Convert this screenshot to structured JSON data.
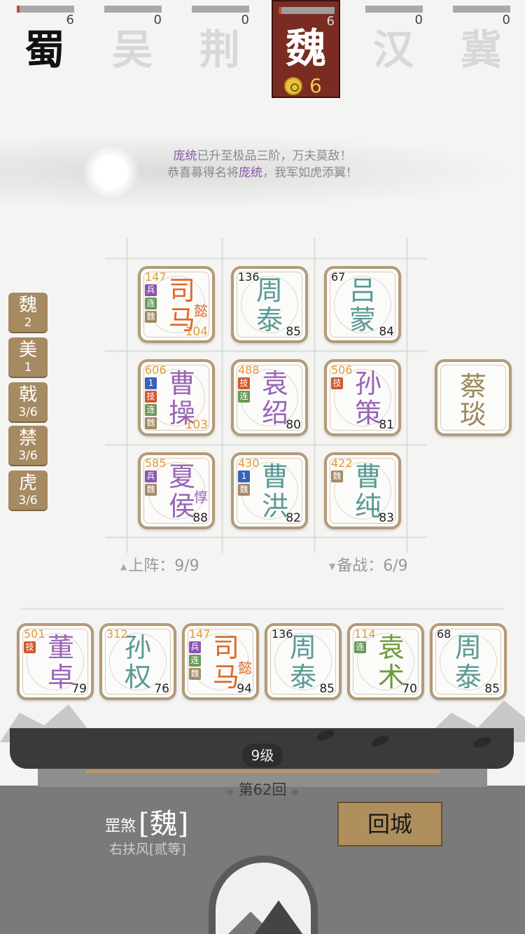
{
  "factions": [
    {
      "key": "shu",
      "glyph": "蜀",
      "count": "6",
      "progress": 0.05,
      "state": "dark"
    },
    {
      "key": "wu",
      "glyph": "吴",
      "count": "0",
      "progress": 0,
      "state": "light"
    },
    {
      "key": "jing",
      "glyph": "荆",
      "count": "0",
      "progress": 0,
      "state": "light"
    },
    {
      "key": "wei",
      "glyph": "魏",
      "count": "6",
      "progress": 0.05,
      "state": "active",
      "coins": "6"
    },
    {
      "key": "han",
      "glyph": "汉",
      "count": "0",
      "progress": 0,
      "state": "light"
    },
    {
      "key": "ji",
      "glyph": "冀",
      "count": "0",
      "progress": 0,
      "state": "light"
    }
  ],
  "notices": {
    "line1": {
      "hl": "庞统",
      "text": "已升至极品三阶，万夫莫敌！"
    },
    "line2": {
      "pre": "恭喜募得名将",
      "hl": "庞统",
      "text": "，我军如虎添翼！"
    }
  },
  "side_tags": [
    {
      "title": "魏",
      "value": "2"
    },
    {
      "title": "美",
      "value": "1"
    },
    {
      "title": "戟",
      "value": "3/6"
    },
    {
      "title": "禁",
      "value": "3/6"
    },
    {
      "title": "虎",
      "value": "3/6"
    }
  ],
  "board": [
    {
      "name_top": "司",
      "name_bot": "马",
      "stat": "147",
      "power": "104",
      "sub": "懿",
      "color": "orange",
      "badges": [
        {
          "t": "兵",
          "c": "purple"
        },
        {
          "t": "连",
          "c": "green"
        },
        {
          "t": "魏",
          "c": "tan"
        }
      ],
      "power_style": "orange"
    },
    {
      "name_top": "周",
      "name_bot": "泰",
      "stat": "136",
      "power": "85",
      "color": "teal",
      "badges": [],
      "stat_style": "black"
    },
    {
      "name_top": "吕",
      "name_bot": "蒙",
      "stat": "67",
      "power": "84",
      "color": "teal",
      "badges": [],
      "stat_style": "black"
    },
    {
      "name_top": "曹",
      "name_bot": "操",
      "stat": "606",
      "power": "103",
      "color": "purple",
      "badges": [
        {
          "t": "1",
          "c": "blue"
        },
        {
          "t": "技",
          "c": "orange"
        },
        {
          "t": "连",
          "c": "green"
        },
        {
          "t": "魏",
          "c": "tan"
        }
      ],
      "power_style": "orange"
    },
    {
      "name_top": "袁",
      "name_bot": "绍",
      "stat": "488",
      "power": "80",
      "color": "purple",
      "badges": [
        {
          "t": "技",
          "c": "orange"
        },
        {
          "t": "连",
          "c": "green"
        }
      ]
    },
    {
      "name_top": "孙",
      "name_bot": "策",
      "stat": "506",
      "power": "81",
      "color": "purple",
      "badges": [
        {
          "t": "技",
          "c": "orange"
        }
      ]
    },
    {
      "name_top": "夏",
      "name_bot": "侯",
      "stat": "585",
      "power": "88",
      "sub": "惇",
      "color": "purple",
      "badges": [
        {
          "t": "兵",
          "c": "purple"
        },
        {
          "t": "魏",
          "c": "tan"
        }
      ]
    },
    {
      "name_top": "曹",
      "name_bot": "洪",
      "stat": "430",
      "power": "82",
      "color": "teal",
      "badges": [
        {
          "t": "1",
          "c": "blue"
        },
        {
          "t": "魏",
          "c": "tan"
        }
      ]
    },
    {
      "name_top": "曹",
      "name_bot": "纯",
      "stat": "422",
      "power": "83",
      "color": "teal",
      "badges": [
        {
          "t": "魏",
          "c": "tan"
        }
      ]
    }
  ],
  "single_card": {
    "name_top": "蔡",
    "name_bot": "琰",
    "color": "brown"
  },
  "counters": {
    "deployed": "上阵：9/9",
    "reserve": "备战：6/9"
  },
  "bench": [
    {
      "name_top": "董",
      "name_bot": "卓",
      "stat": "501",
      "power": "79",
      "color": "purple",
      "badges": [
        {
          "t": "技",
          "c": "orange"
        }
      ]
    },
    {
      "name_top": "孙",
      "name_bot": "权",
      "stat": "312",
      "power": "76",
      "color": "teal",
      "badges": []
    },
    {
      "name_top": "司",
      "name_bot": "马",
      "stat": "147",
      "power": "94",
      "sub": "懿",
      "color": "orange",
      "badges": [
        {
          "t": "兵",
          "c": "purple"
        },
        {
          "t": "连",
          "c": "green"
        },
        {
          "t": "魏",
          "c": "tan"
        }
      ]
    },
    {
      "name_top": "周",
      "name_bot": "泰",
      "stat": "136",
      "power": "85",
      "color": "teal",
      "badges": [],
      "stat_style": "black"
    },
    {
      "name_top": "袁",
      "name_bot": "术",
      "stat": "114",
      "power": "70",
      "color": "green",
      "badges": [
        {
          "t": "连",
          "c": "green"
        }
      ]
    },
    {
      "name_top": "周",
      "name_bot": "泰",
      "stat": "68",
      "power": "85",
      "color": "teal",
      "badges": [],
      "stat_style": "black"
    }
  ],
  "footer": {
    "level": "9级",
    "round": "第62回",
    "rank_prefix": "罡煞",
    "rank_name": "[魏]",
    "rank_title": "右扶风[贰等]",
    "return_label": "回城"
  }
}
